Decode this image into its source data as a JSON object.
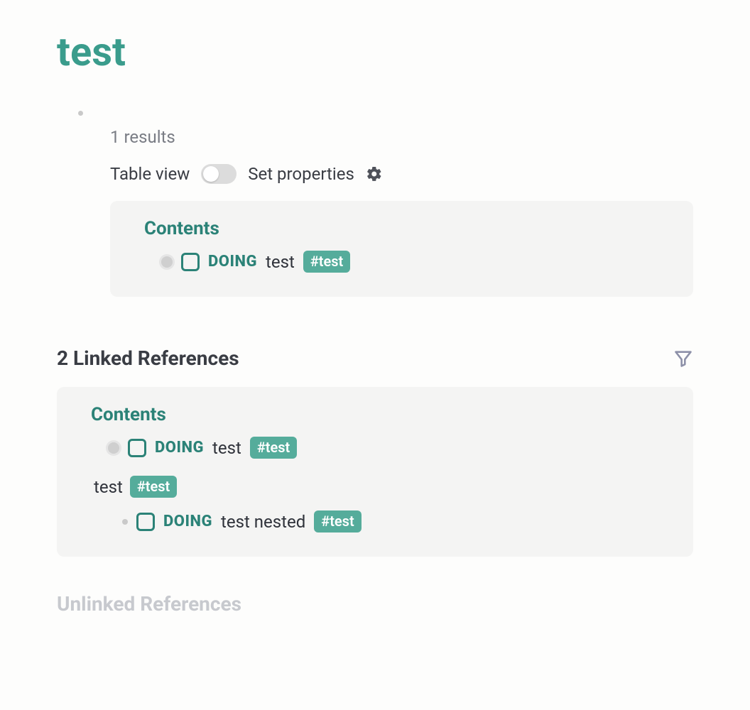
{
  "page": {
    "title": "test"
  },
  "query": {
    "results_label": "1 results",
    "controls": {
      "table_view_label": "Table view",
      "set_properties_label": "Set properties"
    },
    "panel": {
      "header": "Contents",
      "row": {
        "status": "DOING",
        "text": "test",
        "tag": "#test"
      }
    }
  },
  "linked": {
    "title": "2 Linked References",
    "panel": {
      "header": "Contents",
      "row1": {
        "status": "DOING",
        "text": "test",
        "tag": "#test"
      },
      "plain": {
        "text": "test",
        "tag": "#test"
      },
      "nested": {
        "status": "DOING",
        "text": "test nested",
        "tag": "#test"
      }
    }
  },
  "unlinked": {
    "title": "Unlinked References"
  }
}
